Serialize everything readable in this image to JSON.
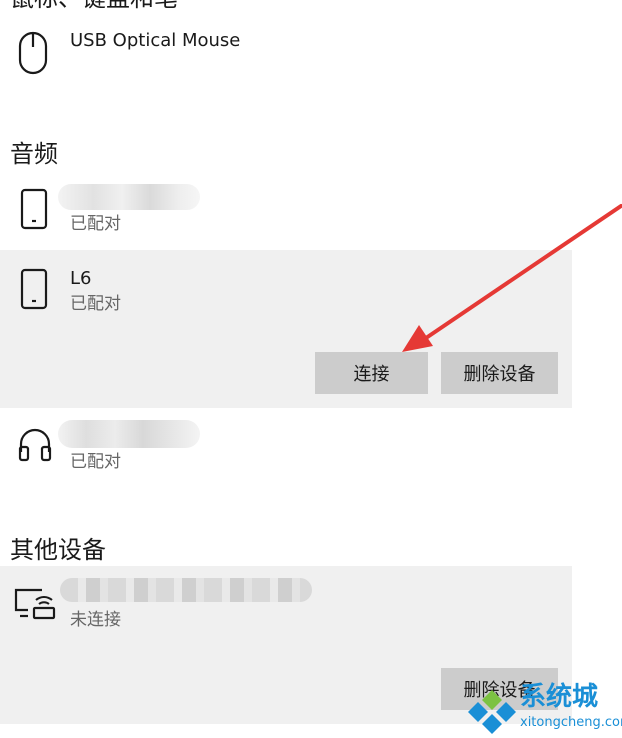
{
  "sections": {
    "mouse_keyboard_pen": {
      "title": "鼠标、键盘和笔"
    },
    "audio": {
      "title": "音频"
    },
    "other": {
      "title": "其他设备"
    }
  },
  "devices": {
    "usb_mouse": {
      "name": "USB Optical Mouse",
      "icon": "mouse-icon"
    },
    "phone_blurred": {
      "status": "已配对",
      "icon": "phone-icon"
    },
    "l6": {
      "name": "L6",
      "status": "已配对",
      "icon": "phone-icon"
    },
    "headphones_blurred": {
      "status": "已配对",
      "icon": "headphones-icon"
    },
    "display_blurred": {
      "status": "未连接",
      "icon": "wireless-display-icon"
    }
  },
  "buttons": {
    "connect": "连接",
    "remove_device": "删除设备",
    "remove_device_2": "删除设备"
  },
  "watermark": {
    "brand": "系统城",
    "url": "xitongcheng.com"
  },
  "colors": {
    "panel_bg": "#f0f0f0",
    "button_bg": "#cccccc",
    "secondary_text": "#666666",
    "arrow": "#e53935",
    "watermark_blue": "#1a8fd6",
    "watermark_green": "#7cc242"
  }
}
